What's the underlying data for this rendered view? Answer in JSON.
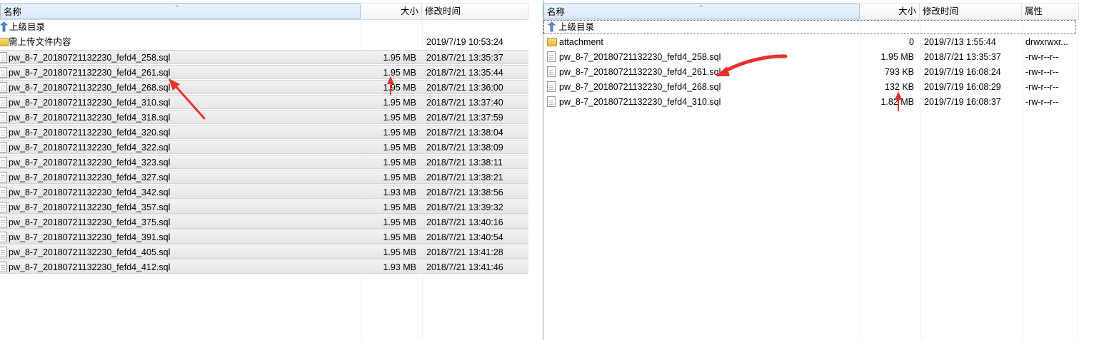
{
  "left": {
    "columns": {
      "name": "名称",
      "size": "大小",
      "modified": "修改时间"
    },
    "up_dir": "上级目录",
    "rows": [
      {
        "type": "folder",
        "name": "需上传文件内容",
        "size": "",
        "modified": "2019/7/19 10:53:24"
      },
      {
        "type": "file",
        "name": "pw_8-7_20180721132230_fefd4_258.sql",
        "size": "1.95 MB",
        "modified": "2018/7/21 13:35:37"
      },
      {
        "type": "file",
        "name": "pw_8-7_20180721132230_fefd4_261.sql",
        "size": "1.95 MB",
        "modified": "2018/7/21 13:35:44"
      },
      {
        "type": "file",
        "name": "pw_8-7_20180721132230_fefd4_268.sql",
        "size": "1.95 MB",
        "modified": "2018/7/21 13:36:00"
      },
      {
        "type": "file",
        "name": "pw_8-7_20180721132230_fefd4_310.sql",
        "size": "1.95 MB",
        "modified": "2018/7/21 13:37:40"
      },
      {
        "type": "file",
        "name": "pw_8-7_20180721132230_fefd4_318.sql",
        "size": "1.95 MB",
        "modified": "2018/7/21 13:37:59"
      },
      {
        "type": "file",
        "name": "pw_8-7_20180721132230_fefd4_320.sql",
        "size": "1.95 MB",
        "modified": "2018/7/21 13:38:04"
      },
      {
        "type": "file",
        "name": "pw_8-7_20180721132230_fefd4_322.sql",
        "size": "1.95 MB",
        "modified": "2018/7/21 13:38:09"
      },
      {
        "type": "file",
        "name": "pw_8-7_20180721132230_fefd4_323.sql",
        "size": "1.95 MB",
        "modified": "2018/7/21 13:38:11"
      },
      {
        "type": "file",
        "name": "pw_8-7_20180721132230_fefd4_327.sql",
        "size": "1.95 MB",
        "modified": "2018/7/21 13:38:21"
      },
      {
        "type": "file",
        "name": "pw_8-7_20180721132230_fefd4_342.sql",
        "size": "1.93 MB",
        "modified": "2018/7/21 13:38:56"
      },
      {
        "type": "file",
        "name": "pw_8-7_20180721132230_fefd4_357.sql",
        "size": "1.95 MB",
        "modified": "2018/7/21 13:39:32"
      },
      {
        "type": "file",
        "name": "pw_8-7_20180721132230_fefd4_375.sql",
        "size": "1.95 MB",
        "modified": "2018/7/21 13:40:16"
      },
      {
        "type": "file",
        "name": "pw_8-7_20180721132230_fefd4_391.sql",
        "size": "1.95 MB",
        "modified": "2018/7/21 13:40:54"
      },
      {
        "type": "file",
        "name": "pw_8-7_20180721132230_fefd4_405.sql",
        "size": "1.95 MB",
        "modified": "2018/7/21 13:41:28"
      },
      {
        "type": "file",
        "name": "pw_8-7_20180721132230_fefd4_412.sql",
        "size": "1.93 MB",
        "modified": "2018/7/21 13:41:46"
      }
    ]
  },
  "right": {
    "columns": {
      "name": "名称",
      "size": "大小",
      "modified": "修改时间",
      "attrs": "属性"
    },
    "up_dir": "上级目录",
    "rows": [
      {
        "type": "folder",
        "name": "attachment",
        "size": "0",
        "modified": "2019/7/13 1:55:44",
        "attrs": "drwxrwxr..."
      },
      {
        "type": "file",
        "name": "pw_8-7_20180721132230_fefd4_258.sql",
        "size": "1.95 MB",
        "modified": "2018/7/21 13:35:37",
        "attrs": "-rw-r--r--"
      },
      {
        "type": "file",
        "name": "pw_8-7_20180721132230_fefd4_261.sql",
        "size": "793 KB",
        "modified": "2019/7/19 16:08:24",
        "attrs": "-rw-r--r--"
      },
      {
        "type": "file",
        "name": "pw_8-7_20180721132230_fefd4_268.sql",
        "size": "132 KB",
        "modified": "2019/7/19 16:08:29",
        "attrs": "-rw-r--r--"
      },
      {
        "type": "file",
        "name": "pw_8-7_20180721132230_fefd4_310.sql",
        "size": "1.82 MB",
        "modified": "2019/7/19 16:08:37",
        "attrs": "-rw-r--r--"
      }
    ]
  },
  "colors": {
    "annotation_arrow": "#e8312a",
    "selection": "#e8e8e8",
    "header_sorted": "#dbeaf8"
  }
}
